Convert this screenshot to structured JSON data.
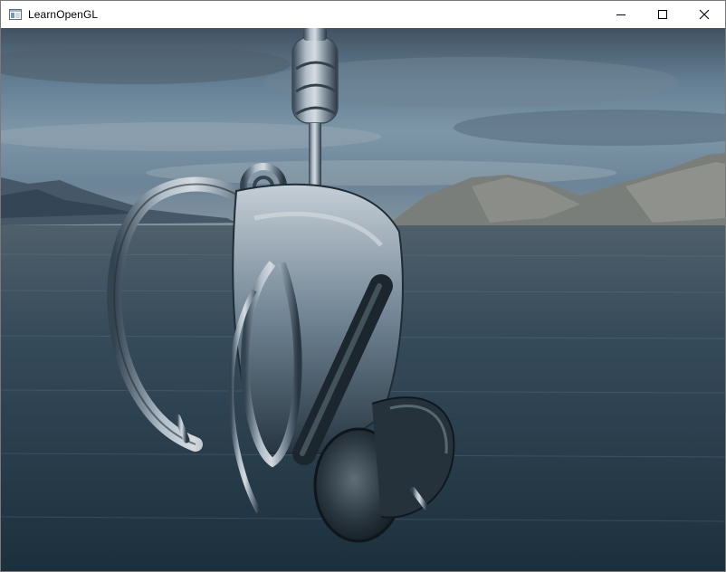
{
  "window": {
    "title": "LearnOpenGL",
    "icon": "app-window-icon",
    "controls": [
      "minimize-icon",
      "maximize-icon",
      "close-icon"
    ]
  },
  "scene": {
    "description_icon": "skybox-reflection-render"
  }
}
